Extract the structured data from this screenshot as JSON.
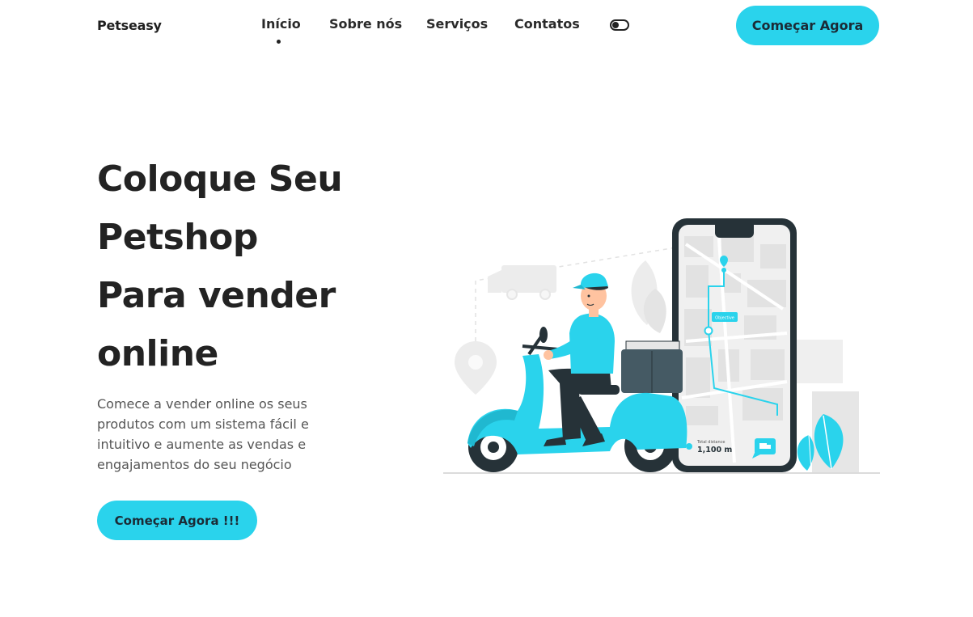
{
  "brand": {
    "name": "Petseasy"
  },
  "nav": {
    "items": [
      {
        "label": "Início",
        "active": true
      },
      {
        "label": "Sobre nós",
        "active": false
      },
      {
        "label": "Serviços",
        "active": false
      },
      {
        "label": "Contatos",
        "active": false
      }
    ],
    "theme_toggle_icon": "toggle-icon",
    "cta_label": "Começar Agora"
  },
  "hero": {
    "title_lines": [
      "Coloque Seu",
      "Petshop",
      "Para vender",
      "online"
    ],
    "description": "Comece a vender online os seus produtos com um sistema fácil e intuitivo e aumente as vendas e engajamentos do seu negócio",
    "cta_label": "Começar Agora !!!"
  },
  "illustration": {
    "map_tag": "Objective",
    "distance_label": "Total distance",
    "distance_value": "1,100 m"
  },
  "colors": {
    "accent": "#2ad3ec",
    "dark": "#263238",
    "text": "#232323",
    "muted": "#555555"
  }
}
